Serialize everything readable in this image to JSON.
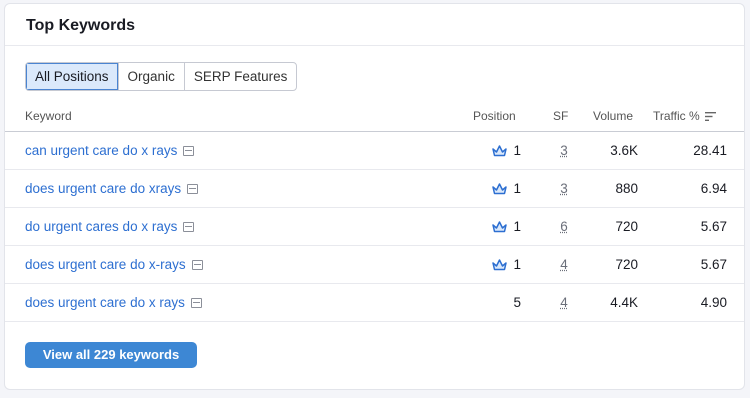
{
  "card": {
    "title": "Top Keywords"
  },
  "tabs": [
    "All Positions",
    "Organic",
    "SERP Features"
  ],
  "columns": {
    "keyword": "Keyword",
    "position": "Position",
    "sf": "SF",
    "volume": "Volume",
    "traffic": "Traffic %"
  },
  "rows": [
    {
      "keyword": "can urgent care do x rays",
      "position": "1",
      "top_icon": true,
      "sf": "3",
      "volume": "3.6K",
      "traffic": "28.41"
    },
    {
      "keyword": "does urgent care do xrays",
      "position": "1",
      "top_icon": true,
      "sf": "3",
      "volume": "880",
      "traffic": "6.94"
    },
    {
      "keyword": "do urgent cares do x rays",
      "position": "1",
      "top_icon": true,
      "sf": "6",
      "volume": "720",
      "traffic": "5.67"
    },
    {
      "keyword": "does urgent care do x-rays",
      "position": "1",
      "top_icon": true,
      "sf": "4",
      "volume": "720",
      "traffic": "5.67"
    },
    {
      "keyword": "does urgent care do x rays",
      "position": "5",
      "top_icon": false,
      "sf": "4",
      "volume": "4.4K",
      "traffic": "4.90"
    }
  ],
  "footer": {
    "button_label": "View all 229 keywords"
  },
  "colors": {
    "link": "#2d6fd1",
    "accent": "#3d87d4",
    "active_tab_bg": "#dbe9fb"
  }
}
